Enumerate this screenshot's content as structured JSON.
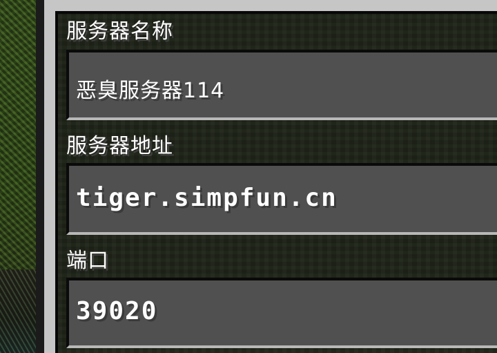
{
  "form": {
    "server_name": {
      "label": "服务器名称",
      "value": "恶臭服务器114"
    },
    "server_address": {
      "label": "服务器地址",
      "value": "tiger.simpfun.cn"
    },
    "port": {
      "label": "端口",
      "value": "39020"
    }
  },
  "colors": {
    "frame": "#c6c6c6",
    "field_bg": "#505050",
    "text": "#ffffff"
  }
}
